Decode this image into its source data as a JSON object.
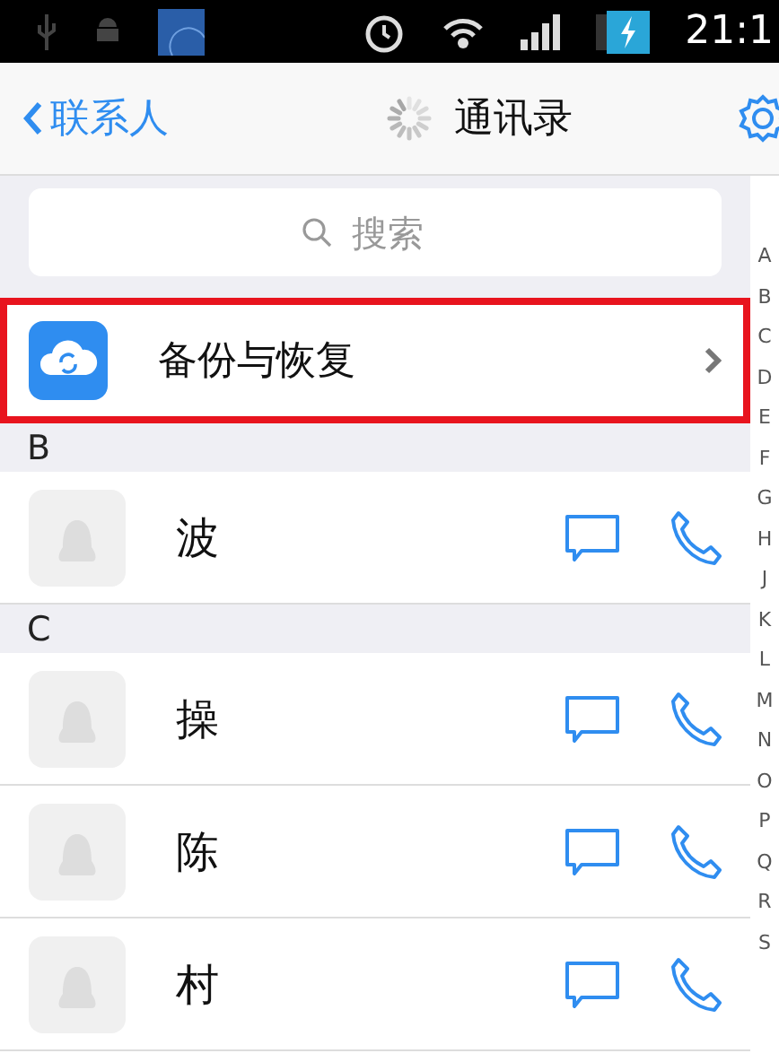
{
  "status_bar": {
    "time": "21:1"
  },
  "nav_bar": {
    "back": "联系人",
    "title": "通讯录",
    "loading": true
  },
  "search": {
    "placeholder": "搜索"
  },
  "backup_row": {
    "label": "备份与恢复",
    "highlighted": true
  },
  "sections": [
    {
      "letter": "B",
      "contacts": [
        {
          "name": "波"
        }
      ]
    },
    {
      "letter": "C",
      "contacts": [
        {
          "name": "操"
        },
        {
          "name": "陈"
        },
        {
          "name": "村"
        }
      ]
    }
  ],
  "index": [
    "A",
    "B",
    "C",
    "D",
    "E",
    "F",
    "G",
    "H",
    "J",
    "K",
    "L",
    "M",
    "N",
    "O",
    "P",
    "Q",
    "R",
    "S"
  ]
}
